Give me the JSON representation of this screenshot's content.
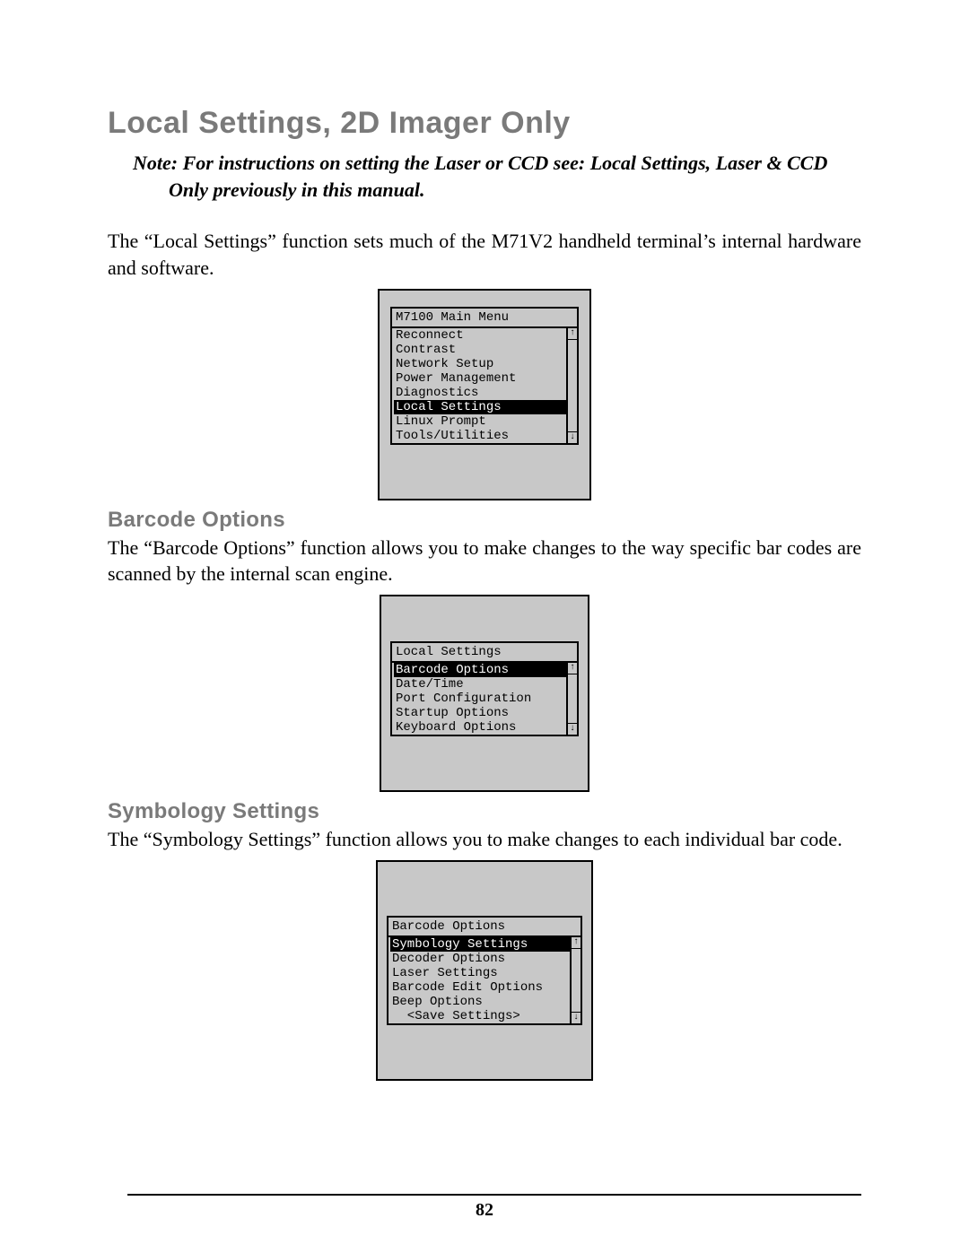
{
  "page": {
    "title": "Local Settings, 2D Imager Only",
    "note_line1": "Note: For instructions on setting the Laser or CCD see: Local Settings, Laser & CCD",
    "note_line2": "Only previously in this manual.",
    "intro": "The “Local Settings” function sets much of the M71V2 handheld terminal’s internal hardware and software.",
    "number": "82"
  },
  "device1": {
    "title": "M7100 Main Menu",
    "items": [
      {
        "label": "Reconnect",
        "selected": false
      },
      {
        "label": "Contrast",
        "selected": false
      },
      {
        "label": "Network Setup",
        "selected": false
      },
      {
        "label": "Power Management",
        "selected": false
      },
      {
        "label": "Diagnostics",
        "selected": false
      },
      {
        "label": "Local Settings",
        "selected": true
      },
      {
        "label": "Linux Prompt",
        "selected": false
      },
      {
        "label": "Tools/Utilities",
        "selected": false
      }
    ],
    "arrow_up": "↑",
    "arrow_down": "↓"
  },
  "section2": {
    "heading": "Barcode Options",
    "para": "The “Barcode Options” function allows you to make changes to the way specific bar codes are scanned by the internal scan engine."
  },
  "device2": {
    "title": "Local Settings",
    "items": [
      {
        "label": "Barcode Options",
        "selected": true
      },
      {
        "label": "Date/Time",
        "selected": false
      },
      {
        "label": "Port Configuration",
        "selected": false
      },
      {
        "label": "Startup Options",
        "selected": false
      },
      {
        "label": "Keyboard Options",
        "selected": false
      }
    ],
    "arrow_up": "↑",
    "arrow_down": "↓"
  },
  "section3": {
    "heading": "Symbology Settings",
    "para": "The “Symbology Settings” function allows you to make changes to each individual bar code."
  },
  "device3": {
    "title": "Barcode Options",
    "items": [
      {
        "label": "Symbology Settings",
        "selected": true
      },
      {
        "label": "Decoder Options",
        "selected": false
      },
      {
        "label": "Laser Settings",
        "selected": false
      },
      {
        "label": "Barcode Edit Options",
        "selected": false
      },
      {
        "label": "Beep Options",
        "selected": false
      },
      {
        "label": "  <Save Settings>",
        "selected": false
      }
    ],
    "arrow_up": "↑",
    "arrow_down": "↓"
  }
}
